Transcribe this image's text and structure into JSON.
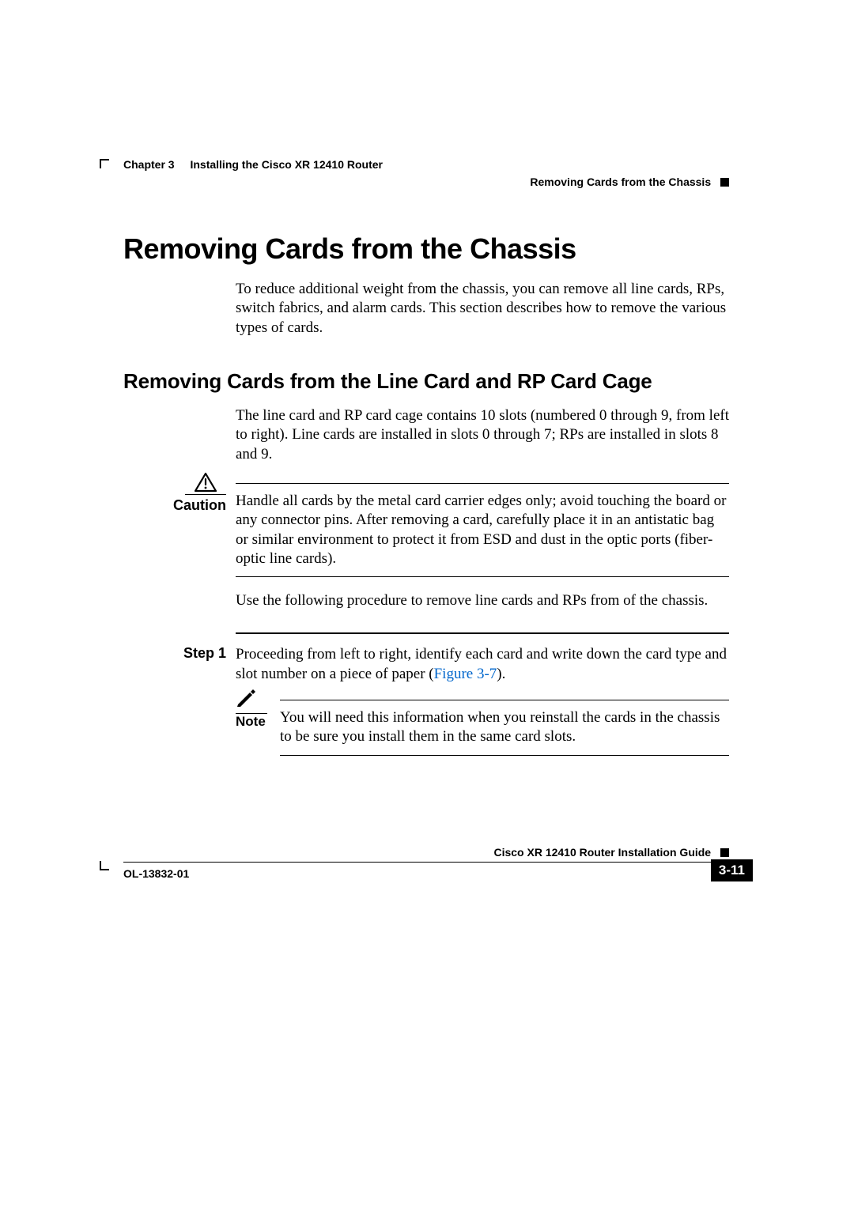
{
  "header": {
    "chapter_label": "Chapter 3",
    "chapter_title": "Installing the Cisco XR 12410 Router",
    "section_title": "Removing Cards from the Chassis"
  },
  "h1": "Removing Cards from the Chassis",
  "intro": "To reduce additional weight from the chassis, you can remove all line cards, RPs, switch fabrics, and alarm cards. This section describes how to remove the various types of cards.",
  "h2": "Removing Cards from the Line Card and RP Card Cage",
  "para2": "The line card and RP card cage contains 10 slots (numbered 0 through 9, from left to right). Line cards are installed in slots 0 through 7; RPs are installed in slots 8 and 9.",
  "caution": {
    "label": "Caution",
    "text": "Handle all cards by the metal card carrier edges only; avoid touching the board or any connector pins. After removing a card, carefully place it in an antistatic bag or similar environment to protect it from ESD and dust in the optic ports (fiber-optic line cards)."
  },
  "para3": "Use the following procedure to remove line cards and RPs from of the chassis.",
  "step1": {
    "label": "Step 1",
    "text_before": "Proceeding from left to right, identify each card and write down the card type and slot number on a piece of paper (",
    "xref": "Figure 3-7",
    "text_after": ")."
  },
  "note": {
    "label": "Note",
    "text": "You will need this information when you reinstall the cards in the chassis to be sure you install them in the same card slots."
  },
  "footer": {
    "guide": "Cisco XR 12410 Router Installation Guide",
    "docnum": "OL-13832-01",
    "pagenum": "3-11"
  }
}
